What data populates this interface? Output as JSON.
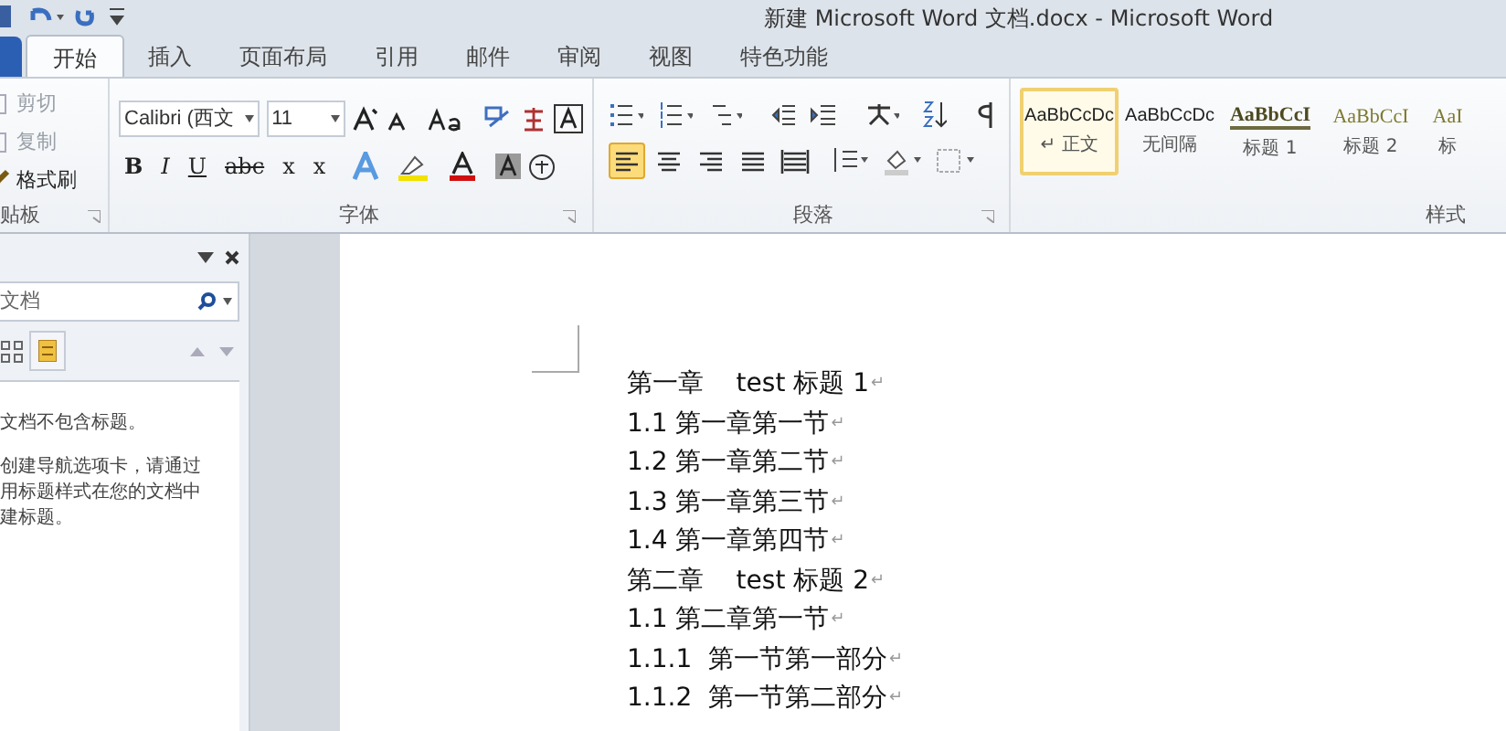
{
  "window": {
    "title": "新建 Microsoft Word 文档.docx  -  Microsoft Word"
  },
  "tabs": [
    {
      "label": "开始",
      "selected": true
    },
    {
      "label": "插入",
      "selected": false
    },
    {
      "label": "页面布局",
      "selected": false
    },
    {
      "label": "引用",
      "selected": false
    },
    {
      "label": "邮件",
      "selected": false
    },
    {
      "label": "审阅",
      "selected": false
    },
    {
      "label": "视图",
      "selected": false
    },
    {
      "label": "特色功能",
      "selected": false
    }
  ],
  "clipboard": {
    "label": "贴板",
    "items": [
      {
        "label": "剪切",
        "disabled": true
      },
      {
        "label": "复制",
        "disabled": true
      },
      {
        "label": "格式刷",
        "disabled": false
      }
    ]
  },
  "font": {
    "label": "字体",
    "font_name": "Calibri (西文",
    "font_size": "11",
    "format_buttons": [
      "B",
      "I",
      "U",
      "abc",
      "x",
      "x"
    ]
  },
  "paragraph": {
    "label": "段落",
    "alignment": [
      {
        "selected": true
      },
      {
        "selected": false
      },
      {
        "selected": false
      },
      {
        "selected": false
      },
      {
        "selected": false
      }
    ]
  },
  "styles": {
    "label": "样式",
    "items": [
      {
        "preview": "AaBbCcDc",
        "name": "正文",
        "mark": "↵",
        "kind": "normal",
        "selected": true
      },
      {
        "preview": "AaBbCcDc",
        "name": "无间隔",
        "kind": "normal",
        "selected": false
      },
      {
        "preview": "AaBbCcI",
        "name": "标题 1",
        "kind": "heading1",
        "selected": false
      },
      {
        "preview": "AaBbCcI",
        "name": "标题 2",
        "kind": "heading2",
        "selected": false
      },
      {
        "preview": "AaI",
        "name": "标",
        "kind": "heading2",
        "selected": false
      }
    ]
  },
  "navigation": {
    "search_value": "文档",
    "messages": [
      "文档不包含标题。",
      "创建导航选项卡，请通过用标题样式在您的文档中建标题。"
    ]
  },
  "document": {
    "lines": [
      {
        "text": "第一章    test 标题 1",
        "mark": "↵"
      },
      {
        "text": "1.1 第一章第一节",
        "mark": "↵"
      },
      {
        "text": "1.2 第一章第二节",
        "mark": "↵"
      },
      {
        "text": "1.3 第一章第三节",
        "mark": "↵"
      },
      {
        "text": "1.4 第一章第四节",
        "mark": "↵"
      },
      {
        "text": "第二章    test 标题 2",
        "mark": "↵"
      },
      {
        "text": "1.1 第二章第一节",
        "mark": "↵"
      },
      {
        "text": "1.1.1  第一节第一部分",
        "mark": "↵"
      },
      {
        "text": "1.1.2  第一节第二部分",
        "mark": "↵"
      }
    ]
  }
}
